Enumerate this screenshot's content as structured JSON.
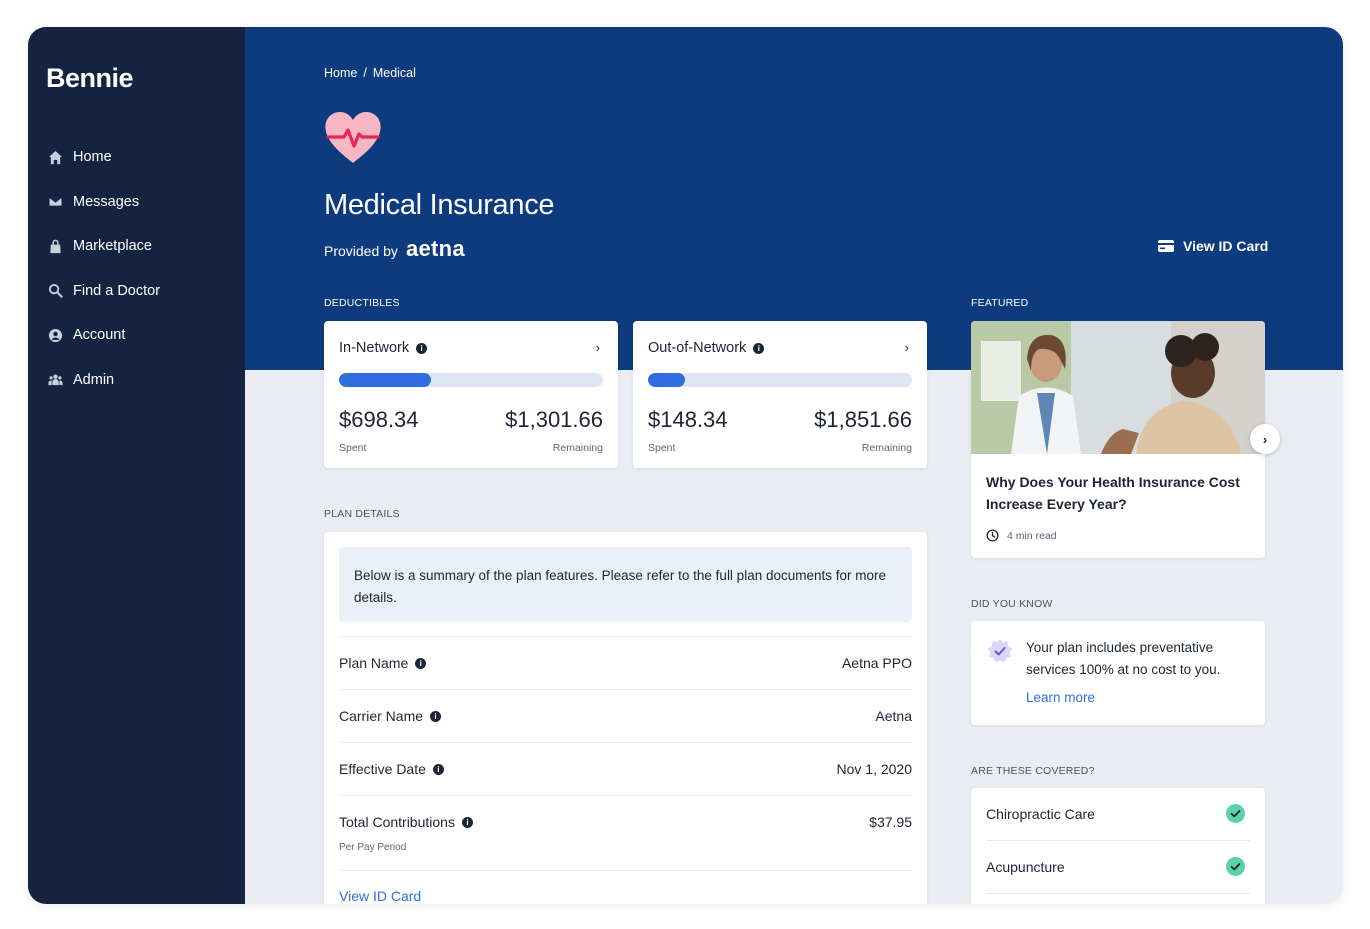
{
  "app": {
    "logo": "Bennie"
  },
  "sidebar": {
    "items": [
      {
        "label": "Home",
        "icon": "home-icon"
      },
      {
        "label": "Messages",
        "icon": "envelope-icon"
      },
      {
        "label": "Marketplace",
        "icon": "shopping-bag-icon"
      },
      {
        "label": "Find a Doctor",
        "icon": "search-icon"
      },
      {
        "label": "Account",
        "icon": "user-circle-icon"
      },
      {
        "label": "Admin",
        "icon": "users-icon"
      }
    ]
  },
  "breadcrumb": {
    "home": "Home",
    "separator": "/",
    "current": "Medical"
  },
  "header": {
    "title": "Medical Insurance",
    "provided_by": "Provided by",
    "provider": "aetna",
    "view_id_card": "View ID Card"
  },
  "sections": {
    "deductibles": "DEDUCTIBLES",
    "featured": "FEATURED",
    "plan_details": "PLAN DETAILS",
    "did_you_know": "DID YOU KNOW",
    "covered": "ARE THESE COVERED?"
  },
  "deductibles": [
    {
      "title": "In-Network",
      "spent": "$698.34",
      "remaining": "$1,301.66",
      "spent_label": "Spent",
      "remaining_label": "Remaining",
      "progress": 0.35
    },
    {
      "title": "Out-of-Network",
      "spent": "$148.34",
      "remaining": "$1,851.66",
      "spent_label": "Spent",
      "remaining_label": "Remaining",
      "progress": 0.14
    }
  ],
  "plan": {
    "summary": "Below is a summary of the plan features. Please refer to the full plan documents for more details.",
    "rows": [
      {
        "label": "Plan Name",
        "value": "Aetna PPO"
      },
      {
        "label": "Carrier Name",
        "value": "Aetna"
      },
      {
        "label": "Effective Date",
        "value": "Nov 1, 2020"
      },
      {
        "label": "Total Contributions",
        "value": "$37.95",
        "sublabel": "Per Pay Period"
      }
    ],
    "view_id_card": "View ID Card"
  },
  "featured": {
    "title": "Why Does Your Health Insurance Cost Increase Every Year?",
    "read_time": "4 min read"
  },
  "did_you_know": {
    "text": "Your plan includes preventative services 100% at no cost to you.",
    "link": "Learn more"
  },
  "covered": [
    {
      "label": "Chiropractic Care",
      "covered": true
    },
    {
      "label": "Acupuncture",
      "covered": true
    }
  ],
  "colors": {
    "sidebar": "#14233f",
    "hero": "#0d3b7d",
    "accent": "#2f6de0",
    "check": "#5ad1a8"
  }
}
